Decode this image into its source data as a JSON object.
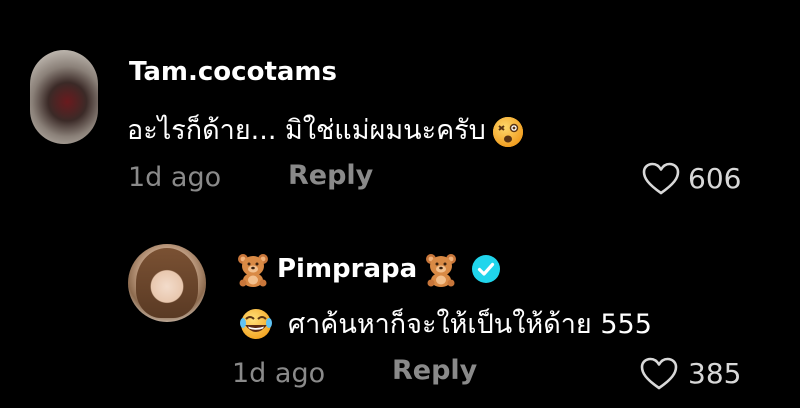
{
  "comments": [
    {
      "username": "Tam.cocotams",
      "text": "อะไรก็ด้าย... มิใช่แม่ผมนะครับ",
      "emoji": "dizzy-face-emoji",
      "time": "1d ago",
      "reply_label": "Reply",
      "likes": "606"
    },
    {
      "username": "Pimprapa",
      "username_decoration": "teddy-bear-emoji",
      "verified": true,
      "text": "ศาค้นหาก็จะให้เป็นให้ด้าย 555",
      "emoji": "laughing-emoji",
      "time": "1d ago",
      "reply_label": "Reply",
      "likes": "385"
    }
  ],
  "colors": {
    "background": "#000000",
    "primary_text": "#ffffff",
    "secondary_text": "#8a8a8a",
    "verified_badge": "#20d5ec"
  }
}
